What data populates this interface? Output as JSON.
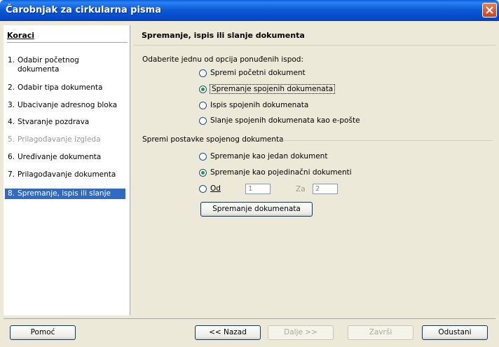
{
  "window": {
    "title": "Čarobnjak za cirkularna pisma"
  },
  "steps": {
    "header": "Koraci",
    "items": [
      {
        "num": "1.",
        "label": "Odabir početnog dokumenta"
      },
      {
        "num": "2.",
        "label": "Odabir tipa dokumenta"
      },
      {
        "num": "3.",
        "label": "Ubacivanje adresnog bloka"
      },
      {
        "num": "4.",
        "label": "Stvaranje pozdrava"
      },
      {
        "num": "5.",
        "label": "Prilagođavanje izgleda"
      },
      {
        "num": "6.",
        "label": "Uređivanje dokumenta"
      },
      {
        "num": "7.",
        "label": "Prilagođavanje dokumenta"
      },
      {
        "num": "8.",
        "label": "Spremanje, ispis ili slanje"
      }
    ]
  },
  "page": {
    "title": "Spremanje, ispis ili slanje dokumenta",
    "prompt": "Odaberite jednu od opcija ponuđenih ispod:",
    "options": [
      "Spremi početni dokument",
      "Spremanje spojenih dokumenata",
      "Ispis spojenih dokumenata",
      "Slanje spojenih dokumenata kao e-pošte"
    ],
    "selected_option": "Spremanje spojenih dokumenata",
    "group_label": "Spremi postavke spojenog dokumenta",
    "save_options": [
      "Spremanje kao jedan dokument",
      "Spremanje kao pojedinačni dokumenti"
    ],
    "selected_save_option": "Spremanje kao pojedinačni dokumenti",
    "from_label": "Od",
    "from_value": "1",
    "to_label": "Za",
    "to_value": "2",
    "save_button": "Spremanje dokumenata"
  },
  "buttons": {
    "help": "Pomoć",
    "back": "<< Nazad",
    "next": "Dalje >>",
    "finish": "Završi",
    "cancel": "Odustani"
  }
}
